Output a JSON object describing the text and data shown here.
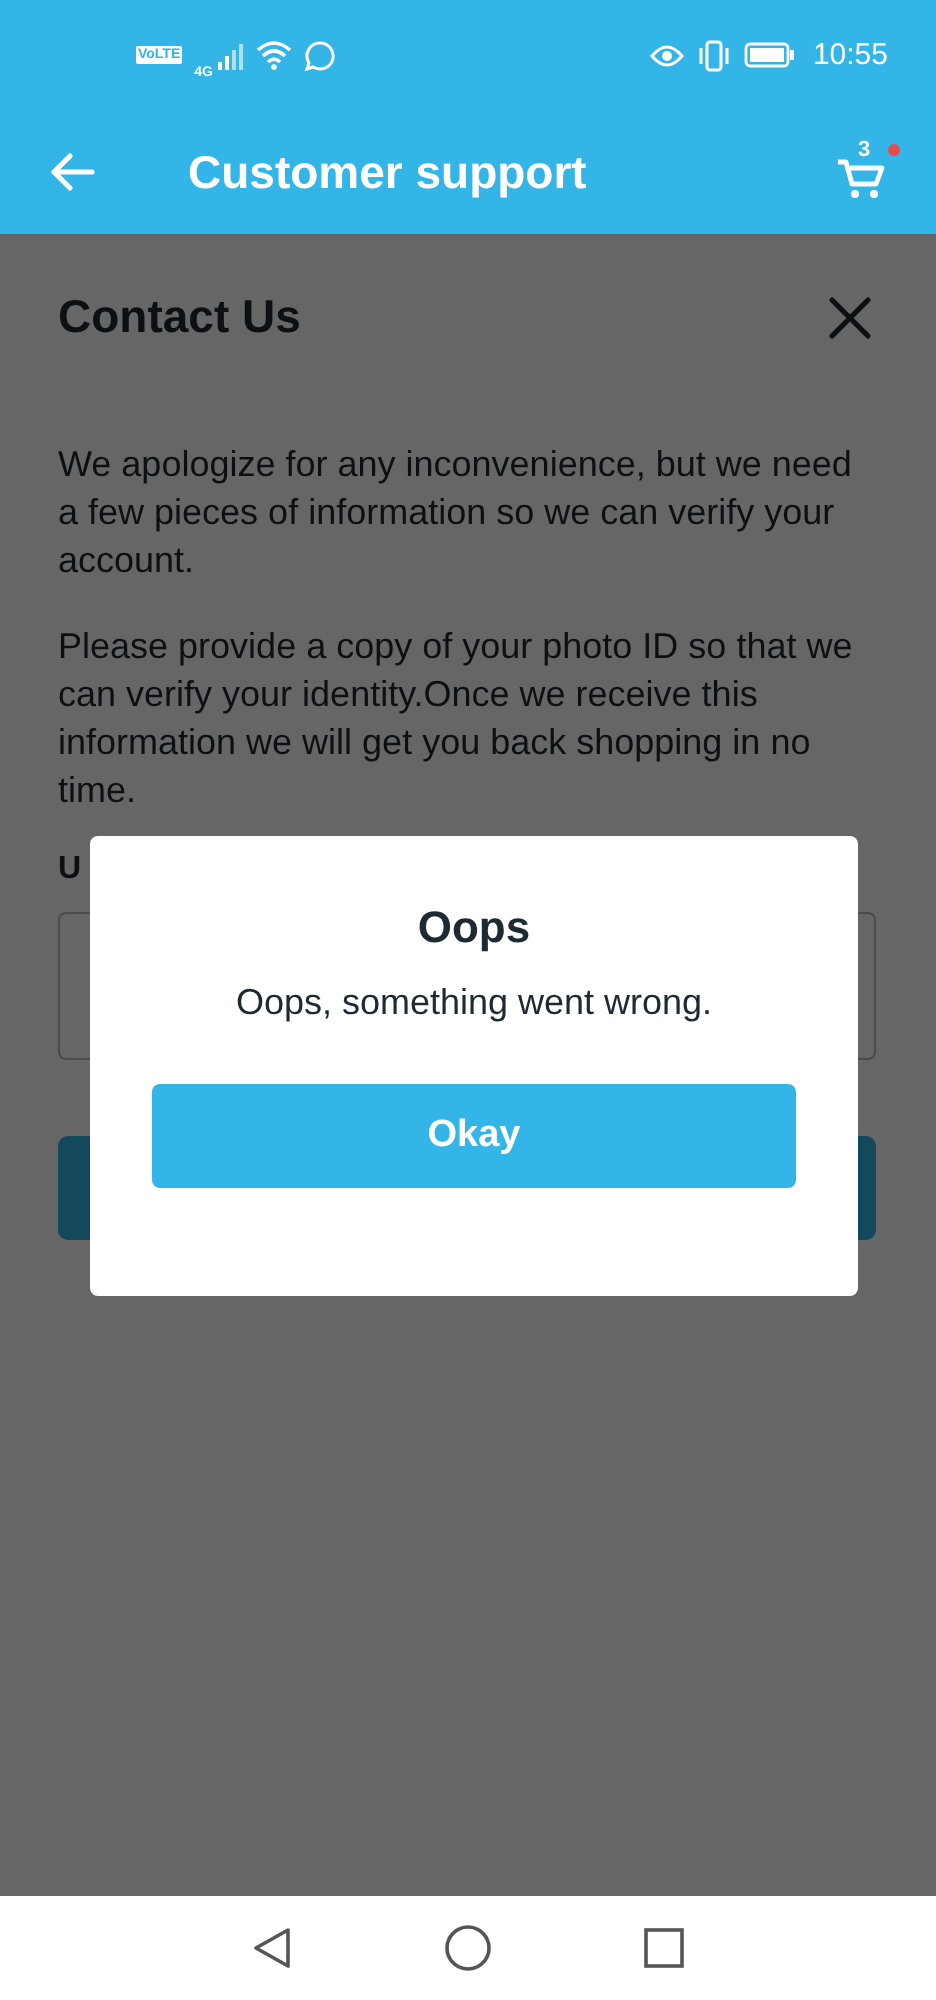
{
  "status_bar": {
    "volte": "VoLTE",
    "network": "4G",
    "time": "10:55"
  },
  "header": {
    "title": "Customer support",
    "cart_count": "3",
    "cart_alert": true
  },
  "content": {
    "title": "Contact Us",
    "paragraphs": [
      "We apologize for any inconvenience, but we need a few pieces of information so we can verify your account.",
      "Please provide a copy of your photo ID so that we can verify your identity.Once we receive this information we will get you back shopping in no time."
    ],
    "field_label": "U"
  },
  "dialog": {
    "title": "Oops",
    "message": "Oops, something went wrong.",
    "button": "Okay"
  }
}
